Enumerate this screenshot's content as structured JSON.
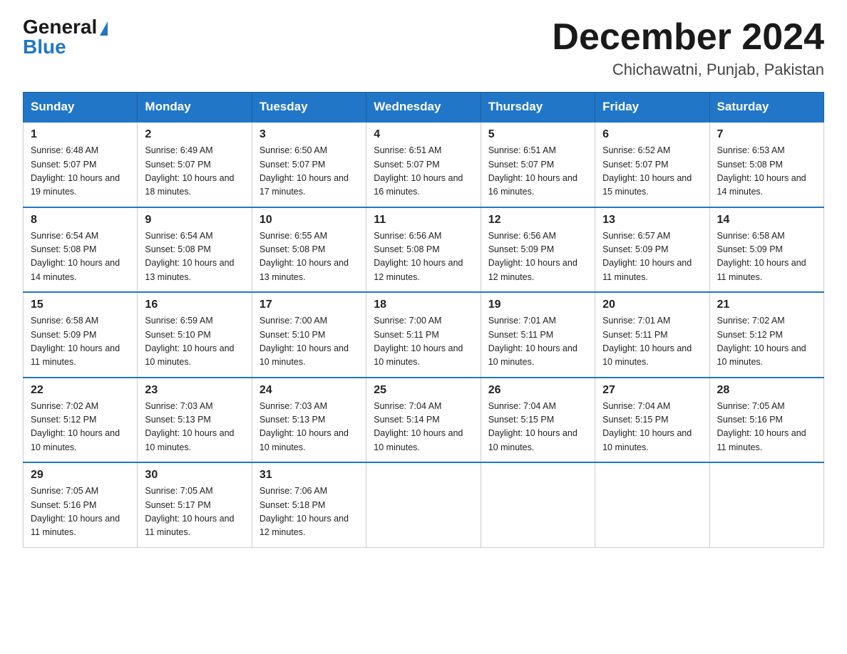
{
  "logo": {
    "general": "General",
    "blue": "Blue"
  },
  "title": "December 2024",
  "location": "Chichawatni, Punjab, Pakistan",
  "days_header": [
    "Sunday",
    "Monday",
    "Tuesday",
    "Wednesday",
    "Thursday",
    "Friday",
    "Saturday"
  ],
  "weeks": [
    [
      {
        "day": 1,
        "sunrise": "6:48 AM",
        "sunset": "5:07 PM",
        "daylight": "10 hours and 19 minutes."
      },
      {
        "day": 2,
        "sunrise": "6:49 AM",
        "sunset": "5:07 PM",
        "daylight": "10 hours and 18 minutes."
      },
      {
        "day": 3,
        "sunrise": "6:50 AM",
        "sunset": "5:07 PM",
        "daylight": "10 hours and 17 minutes."
      },
      {
        "day": 4,
        "sunrise": "6:51 AM",
        "sunset": "5:07 PM",
        "daylight": "10 hours and 16 minutes."
      },
      {
        "day": 5,
        "sunrise": "6:51 AM",
        "sunset": "5:07 PM",
        "daylight": "10 hours and 16 minutes."
      },
      {
        "day": 6,
        "sunrise": "6:52 AM",
        "sunset": "5:07 PM",
        "daylight": "10 hours and 15 minutes."
      },
      {
        "day": 7,
        "sunrise": "6:53 AM",
        "sunset": "5:08 PM",
        "daylight": "10 hours and 14 minutes."
      }
    ],
    [
      {
        "day": 8,
        "sunrise": "6:54 AM",
        "sunset": "5:08 PM",
        "daylight": "10 hours and 14 minutes."
      },
      {
        "day": 9,
        "sunrise": "6:54 AM",
        "sunset": "5:08 PM",
        "daylight": "10 hours and 13 minutes."
      },
      {
        "day": 10,
        "sunrise": "6:55 AM",
        "sunset": "5:08 PM",
        "daylight": "10 hours and 13 minutes."
      },
      {
        "day": 11,
        "sunrise": "6:56 AM",
        "sunset": "5:08 PM",
        "daylight": "10 hours and 12 minutes."
      },
      {
        "day": 12,
        "sunrise": "6:56 AM",
        "sunset": "5:09 PM",
        "daylight": "10 hours and 12 minutes."
      },
      {
        "day": 13,
        "sunrise": "6:57 AM",
        "sunset": "5:09 PM",
        "daylight": "10 hours and 11 minutes."
      },
      {
        "day": 14,
        "sunrise": "6:58 AM",
        "sunset": "5:09 PM",
        "daylight": "10 hours and 11 minutes."
      }
    ],
    [
      {
        "day": 15,
        "sunrise": "6:58 AM",
        "sunset": "5:09 PM",
        "daylight": "10 hours and 11 minutes."
      },
      {
        "day": 16,
        "sunrise": "6:59 AM",
        "sunset": "5:10 PM",
        "daylight": "10 hours and 10 minutes."
      },
      {
        "day": 17,
        "sunrise": "7:00 AM",
        "sunset": "5:10 PM",
        "daylight": "10 hours and 10 minutes."
      },
      {
        "day": 18,
        "sunrise": "7:00 AM",
        "sunset": "5:11 PM",
        "daylight": "10 hours and 10 minutes."
      },
      {
        "day": 19,
        "sunrise": "7:01 AM",
        "sunset": "5:11 PM",
        "daylight": "10 hours and 10 minutes."
      },
      {
        "day": 20,
        "sunrise": "7:01 AM",
        "sunset": "5:11 PM",
        "daylight": "10 hours and 10 minutes."
      },
      {
        "day": 21,
        "sunrise": "7:02 AM",
        "sunset": "5:12 PM",
        "daylight": "10 hours and 10 minutes."
      }
    ],
    [
      {
        "day": 22,
        "sunrise": "7:02 AM",
        "sunset": "5:12 PM",
        "daylight": "10 hours and 10 minutes."
      },
      {
        "day": 23,
        "sunrise": "7:03 AM",
        "sunset": "5:13 PM",
        "daylight": "10 hours and 10 minutes."
      },
      {
        "day": 24,
        "sunrise": "7:03 AM",
        "sunset": "5:13 PM",
        "daylight": "10 hours and 10 minutes."
      },
      {
        "day": 25,
        "sunrise": "7:04 AM",
        "sunset": "5:14 PM",
        "daylight": "10 hours and 10 minutes."
      },
      {
        "day": 26,
        "sunrise": "7:04 AM",
        "sunset": "5:15 PM",
        "daylight": "10 hours and 10 minutes."
      },
      {
        "day": 27,
        "sunrise": "7:04 AM",
        "sunset": "5:15 PM",
        "daylight": "10 hours and 10 minutes."
      },
      {
        "day": 28,
        "sunrise": "7:05 AM",
        "sunset": "5:16 PM",
        "daylight": "10 hours and 11 minutes."
      }
    ],
    [
      {
        "day": 29,
        "sunrise": "7:05 AM",
        "sunset": "5:16 PM",
        "daylight": "10 hours and 11 minutes."
      },
      {
        "day": 30,
        "sunrise": "7:05 AM",
        "sunset": "5:17 PM",
        "daylight": "10 hours and 11 minutes."
      },
      {
        "day": 31,
        "sunrise": "7:06 AM",
        "sunset": "5:18 PM",
        "daylight": "10 hours and 12 minutes."
      },
      null,
      null,
      null,
      null
    ]
  ]
}
